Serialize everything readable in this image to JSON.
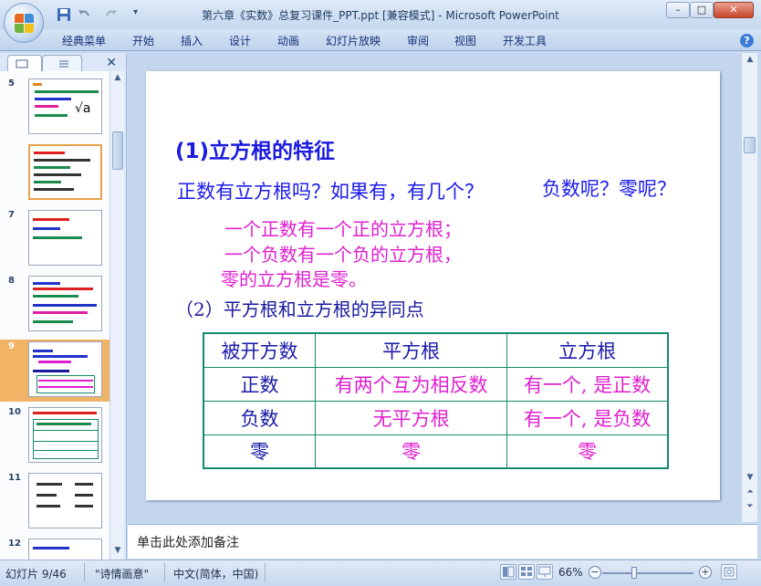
{
  "window": {
    "title": "第六章《实数》总复习课件_PPT.ppt [兼容模式] - Microsoft PowerPoint",
    "minimize": "–",
    "maximize": "□",
    "close": "✕"
  },
  "ribbon": {
    "tabs": [
      "经典菜单",
      "开始",
      "插入",
      "设计",
      "动画",
      "幻灯片放映",
      "审阅",
      "视图",
      "开发工具"
    ],
    "help": "?"
  },
  "left_panel": {
    "close": "✕",
    "thumbnails": [
      {
        "number": "5"
      },
      {
        "number": ""
      },
      {
        "number": "7"
      },
      {
        "number": "8"
      },
      {
        "number": "9",
        "selected": true
      },
      {
        "number": "10"
      },
      {
        "number": "11"
      },
      {
        "number": "12"
      }
    ]
  },
  "slide": {
    "heading": "(1)立方根的特征",
    "question": "正数有立方根吗？如果有，有几个？",
    "question2": "负数呢？零呢？",
    "answers": [
      "一个正数有一个正的立方根；",
      "一个负数有一个负的立方根，",
      "零的立方根是零。"
    ],
    "subheading": "（2）平方根和立方根的异同点",
    "table": {
      "headers": [
        "被开方数",
        "平方根",
        "立方根"
      ],
      "rows": [
        [
          "正数",
          "有两个互为相反数",
          "有一个, 是正数"
        ],
        [
          "负数",
          "无平方根",
          "有一个, 是负数"
        ],
        [
          "零",
          "零",
          "零"
        ]
      ]
    }
  },
  "notes": {
    "placeholder": "单击此处添加备注"
  },
  "status": {
    "slide_info": "幻灯片 9/46",
    "theme": "\"诗情画意\"",
    "language": "中文(简体，中国)",
    "zoom": "66%"
  },
  "colors": {
    "slide_blue": "#1a1aee",
    "slide_pink": "#e020d0",
    "table_border": "#138a6b",
    "selection": "#f1b365"
  }
}
